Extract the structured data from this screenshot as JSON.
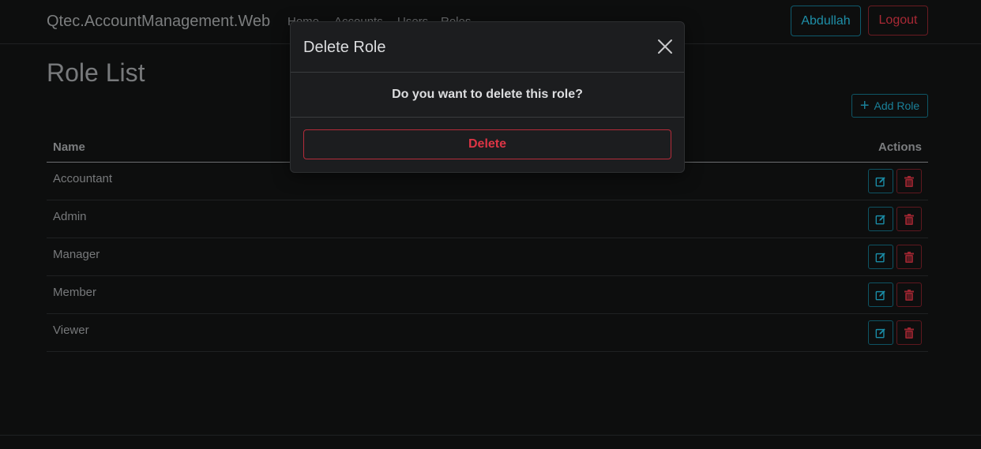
{
  "navbar": {
    "brand": "Qtec.AccountManagement.Web",
    "links": [
      "Home",
      "Accounts",
      "Users",
      "Roles"
    ],
    "user_button": "Abdullah",
    "logout_button": "Logout"
  },
  "page": {
    "title": "Role List",
    "add_button": "Add Role"
  },
  "table": {
    "headers": {
      "name": "Name",
      "actions": "Actions"
    },
    "rows": [
      "Accountant",
      "Admin",
      "Manager",
      "Member",
      "Viewer"
    ]
  },
  "modal": {
    "title": "Delete Role",
    "message": "Do you want to delete this role?",
    "confirm_button": "Delete"
  },
  "icons": {
    "edit": "edit-icon",
    "delete": "trash-icon",
    "close": "close-icon",
    "add": "plus-icon"
  },
  "colors": {
    "info": "#1e8fa8",
    "danger": "#dc3545",
    "background": "#0d0e0e",
    "modal_bg": "#1c1d1f"
  }
}
